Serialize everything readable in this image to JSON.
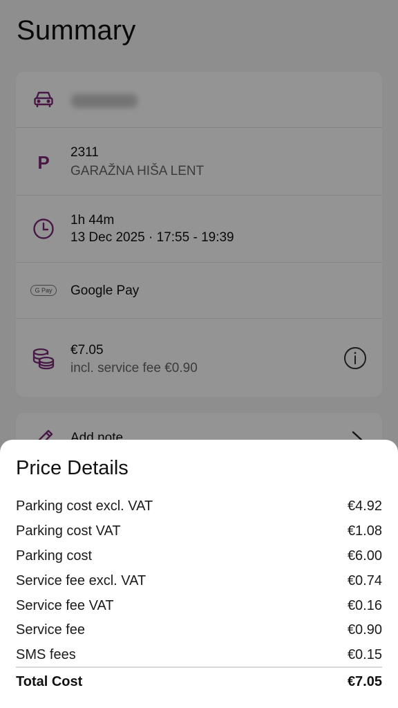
{
  "screen": {
    "title": "Summary"
  },
  "summary": {
    "vehicle": {
      "icon": "car-icon"
    },
    "location": {
      "icon": "parking-p-icon",
      "icon_glyph": "P",
      "code": "2311",
      "name": "GARAŽNA HIŠA LENT"
    },
    "duration": {
      "icon": "clock-icon",
      "length": "1h 44m",
      "datetime": "13 Dec 2025 · 17:55 - 19:39"
    },
    "payment": {
      "icon": "google-pay-icon",
      "badge": "G Pay",
      "method": "Google Pay"
    },
    "cost": {
      "icon": "coins-icon",
      "amount": "€7.05",
      "fee_note": "incl. service fee €0.90",
      "info_icon": "info-icon"
    }
  },
  "note": {
    "label": "Add note",
    "icon": "pencil-icon",
    "chevron": "chevron-right-icon"
  },
  "price_details": {
    "title": "Price Details",
    "rows": [
      {
        "label": "Parking cost excl. VAT",
        "value": "€4.92"
      },
      {
        "label": "Parking cost VAT",
        "value": "€1.08"
      },
      {
        "label": "Parking cost",
        "value": "€6.00"
      },
      {
        "label": "Service fee excl. VAT",
        "value": "€0.74"
      },
      {
        "label": "Service fee VAT",
        "value": "€0.16"
      },
      {
        "label": "Service fee",
        "value": "€0.90"
      },
      {
        "label": "SMS fees",
        "value": "€0.15"
      }
    ],
    "total_label": "Total Cost",
    "total_value": "€7.05"
  },
  "colors": {
    "accent": "#7b2a78",
    "overlay": "rgba(0,0,0,0.42)"
  }
}
